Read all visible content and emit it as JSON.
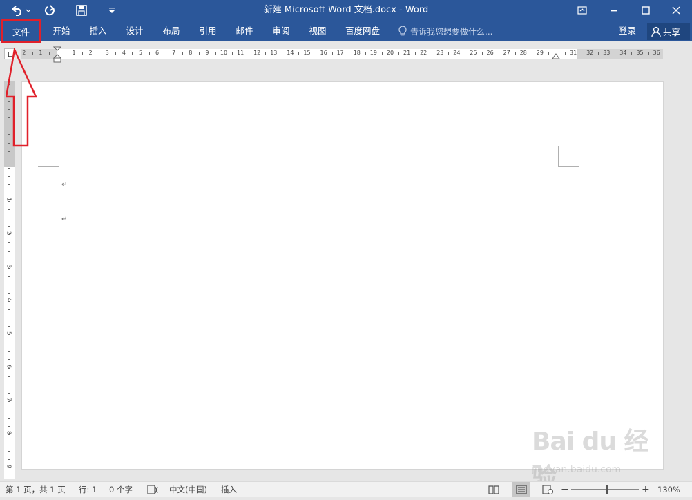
{
  "window": {
    "title": "新建 Microsoft Word 文档.docx - Word"
  },
  "ribbon": {
    "tabs": [
      {
        "label": "文件"
      },
      {
        "label": "开始"
      },
      {
        "label": "插入"
      },
      {
        "label": "设计"
      },
      {
        "label": "布局"
      },
      {
        "label": "引用"
      },
      {
        "label": "邮件"
      },
      {
        "label": "审阅"
      },
      {
        "label": "视图"
      },
      {
        "label": "百度网盘"
      }
    ],
    "tell_me": "告诉我您想要做什么...",
    "login": "登录",
    "share": "共享"
  },
  "ruler": {
    "left_numbers": [
      "2",
      "1"
    ],
    "numbers": [
      "1",
      "2",
      "3",
      "4",
      "5",
      "6",
      "7",
      "8",
      "9",
      "10",
      "11",
      "12",
      "13",
      "14",
      "15",
      "16",
      "17",
      "18",
      "19",
      "20",
      "21",
      "22",
      "23",
      "24",
      "25",
      "26",
      "27",
      "28",
      "29"
    ],
    "right_numbers": [
      "31",
      "32",
      "33",
      "34",
      "35",
      "36"
    ],
    "vertical_numbers": [
      "1",
      "2",
      "3",
      "4",
      "5",
      "6",
      "7",
      "8",
      "9"
    ]
  },
  "document": {
    "paragraph_marks": [
      "↵",
      "↵"
    ]
  },
  "status": {
    "page": "第 1 页，共 1 页",
    "line": "行: 1",
    "words": "0 个字",
    "language": "中文(中国)",
    "mode": "插入",
    "zoom": "130%"
  },
  "watermark": {
    "logo": "Bai du 经验",
    "url": "jingyan.baidu.com"
  },
  "colors": {
    "ribbon": "#2b579a",
    "highlight": "#e0202a"
  }
}
